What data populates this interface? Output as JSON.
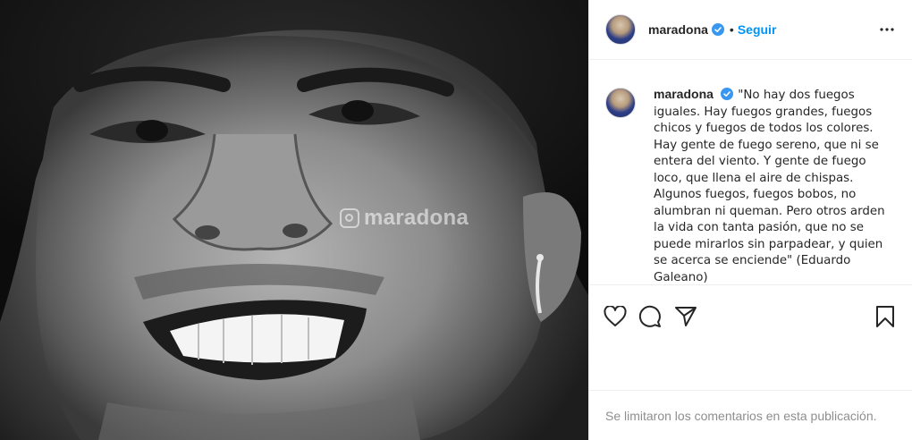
{
  "post": {
    "watermark_text": "maradona",
    "header": {
      "username": "maradona",
      "separator": "•",
      "follow_label": "Seguir"
    },
    "caption": {
      "username": "maradona",
      "text": "\"No hay dos fuegos iguales. Hay fuegos grandes, fuegos chicos y fuegos de todos los colores. Hay gente de fuego sereno, que ni se entera del viento. Y gente de fuego loco, que llena el aire de chispas. Algunos fuegos, fuegos bobos, no alumbran ni queman. Pero otros arden la vida con tanta pasión, que no se puede mirarlos sin parpadear, y quien se acerca se enciende\" (Eduardo Galeano)"
    },
    "actions": {
      "like_icon": "heart-icon",
      "comment_icon": "comment-icon",
      "share_icon": "share-icon",
      "save_icon": "bookmark-icon"
    },
    "footer": {
      "comments_limited": "Se limitaron los comentarios en esta publicación."
    }
  },
  "colors": {
    "accent": "#0095f6",
    "verified": "#3897f0",
    "text": "#262626",
    "muted": "#8e8e8e",
    "border": "#efefef"
  }
}
